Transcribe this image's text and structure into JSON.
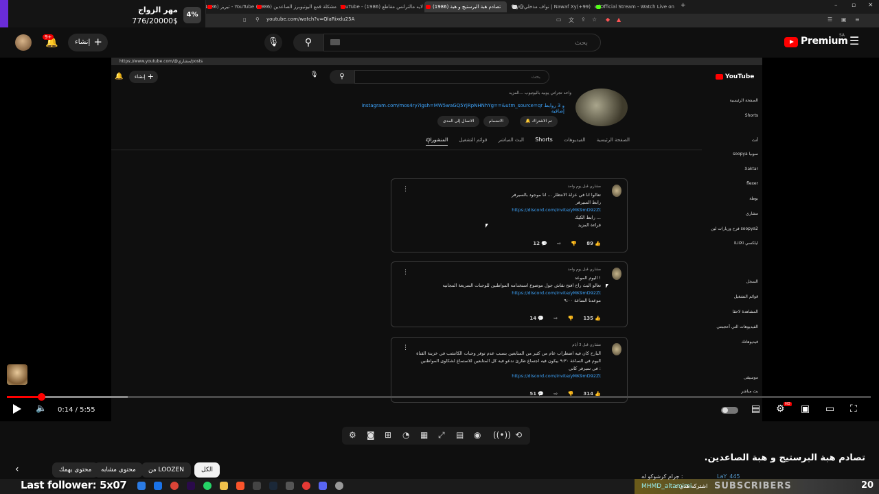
{
  "browser": {
    "tabs": [
      {
        "label": "YouTube - تيريز (1986)"
      },
      {
        "label": "مشكلة قمع اليوتيوبرز الصاعدين (1986)"
      },
      {
        "label": "لايه مالترانس مقاطع (1986) - YouTube"
      },
      {
        "label": "تصادم هبة البرستيج و هبة (1986)",
        "active": true
      },
      {
        "label": "(Nawaf Xy(+99 | نواف مذخلي@yfay"
      },
      {
        "label": "aLiOfficial Stream - Watch Live on..."
      }
    ],
    "url": "youtube.com/watch?v=QlaRixdu25A"
  },
  "donation": {
    "title": "مهر الزواج",
    "amount": "776/20000$",
    "percent": "4%",
    "fill": 0.04
  },
  "header": {
    "notification_badge": "9+",
    "create_label": "إنشاء",
    "search_placeholder": "بحث",
    "brand": "Premium",
    "region": "SA"
  },
  "inner_page": {
    "url": "https://www.youtube.com/@مشاري/posts",
    "create_label": "إنشاء",
    "search_placeholder": "بحث",
    "logo": "YouTube",
    "channel_description": "واحد تجراتي يوبيد باليوتيوب ...المزيد",
    "channel_link": "instagram.com/mos4ry?igsh=MW5waGQ5YjRpNHNhYg==&utm_source=qr و 3 روابط إضافية",
    "buttons": {
      "subscribed": "تم الاشتراك",
      "join": "الانضمام",
      "contact": "الاتصال إلى المدى"
    },
    "tabs": [
      "الصفحة الرئيسية",
      "الفيديوهات",
      "Shorts",
      "البث المباشر",
      "قوائم التشغيل",
      "المنشورات"
    ],
    "active_tab": "المنشورات",
    "posts": [
      {
        "author": "مشاري  قبل يوم واحد",
        "lines": [
          "تعالوا انا في عزلة الانتظار ... انا موجود بالسيرفر",
          "رابط السيرفر"
        ],
        "link": "https://discord.com/invite/yMK9mD92Zt",
        "tail": "رابط الكيك ...\nقراءة المزيد",
        "likes": "89",
        "comments": "12"
      },
      {
        "author": "مشاري  قبل يوم واحد",
        "lines": [
          "اليوم الموعد !",
          "تعالو البث راح افتح نقاش جول موضوع استخدامه المواطنين للوجبات السريعة المجانيه"
        ],
        "link": "https://discord.com/invite/yMK9mD92Zt",
        "tail": "موعدنا الساعة ٩:٠٠",
        "likes": "135",
        "comments": "14"
      },
      {
        "author": "مشاري  قبل 3 أيام",
        "lines": [
          "البارح كان فيه اضطراب عام من كثير من المتابعين بسبب عدم توفر وجبات الكاتشب في خزينة القناة",
          "اليوم في الساعة ٩:٣٠ بيكون فيه اجتماع طارئ ندعو فيه كل المتابعين للاستماع لشكاوى المواطنين",
          "في سيرفر كاتي :"
        ],
        "link": "https://discord.com/invite/yMK9mD92Zt",
        "tail": "",
        "likes": "314",
        "comments": "51"
      }
    ],
    "sidebar": [
      "الصفحة الرئيسية",
      "Shorts",
      "أنت",
      "soopya سوبيا",
      "Xaktar",
      "flexer",
      "بوطة",
      "مشاري",
      "فرح وزيارات لين soopya2",
      "iLiiXi ايلكسي",
      "السجل",
      "قوائم التشغيل",
      "المشاهدة لاحقا",
      "الفيديوهات التي أعجبتني",
      "فيديوهاتك",
      "موسيقى",
      "بث مباشر"
    ]
  },
  "player": {
    "current_time": "0:14",
    "duration": "5:55",
    "time_display": "0:14 / 5:55",
    "progress": 0.0394,
    "buffered": 0.14
  },
  "video": {
    "title": "تصادم هبة البرستيج و هبة الصاعدين."
  },
  "chips": [
    {
      "label": "الكل",
      "active": true
    },
    {
      "label": "من LOOZEN"
    },
    {
      "label": "محتوى مشابه"
    },
    {
      "label": "محتوى يهمك"
    }
  ],
  "stream_overlay": {
    "last_follower": "Last follower: 5x07",
    "ticker_from": "جرام كرشوكو له :",
    "ticker_from_user": "LaY_445",
    "ticker_user": "MHMD_altamimi",
    "ticker_message": "اشتركه هذي :",
    "subscribers_label": "SUBSCRIBERS",
    "subscribers_count": "20",
    "channel_name": "LOOZEN"
  }
}
